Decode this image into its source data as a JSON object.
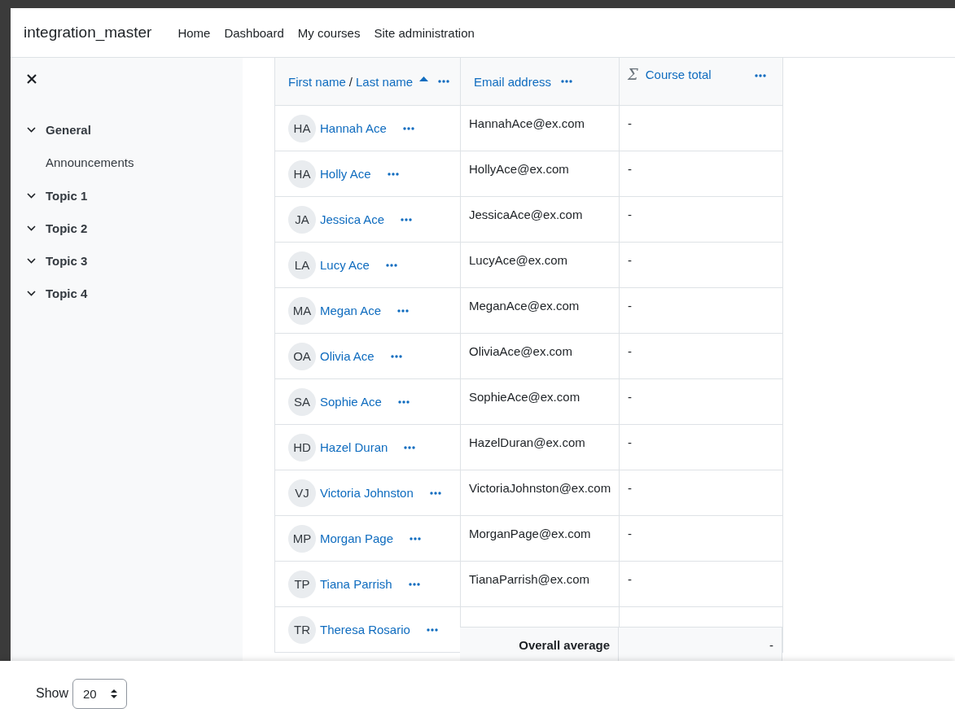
{
  "navbar": {
    "brand": "integration_master",
    "links": [
      "Home",
      "Dashboard",
      "My courses",
      "Site administration"
    ]
  },
  "sidebar": {
    "items": [
      {
        "label": "General",
        "expanded": true,
        "children": [
          {
            "label": "Announcements"
          }
        ]
      },
      {
        "label": "Topic 1",
        "expanded": true
      },
      {
        "label": "Topic 2",
        "expanded": true
      },
      {
        "label": "Topic 3",
        "expanded": true
      },
      {
        "label": "Topic 4",
        "expanded": true
      }
    ]
  },
  "table": {
    "columns": [
      {
        "kind": "name",
        "first_label": "First name",
        "separator": "/",
        "last_label": "Last name",
        "sorted_ascending": true
      },
      {
        "kind": "text",
        "label": "Email address"
      },
      {
        "kind": "total",
        "symbol": "Σ",
        "label": "Course total"
      }
    ],
    "rows": [
      {
        "initials": "HA",
        "name": "Hannah Ace",
        "email": "HannahAce@ex.com",
        "total": "-"
      },
      {
        "initials": "HA",
        "name": "Holly Ace",
        "email": "HollyAce@ex.com",
        "total": "-"
      },
      {
        "initials": "JA",
        "name": "Jessica Ace",
        "email": "JessicaAce@ex.com",
        "total": "-"
      },
      {
        "initials": "LA",
        "name": "Lucy Ace",
        "email": "LucyAce@ex.com",
        "total": "-"
      },
      {
        "initials": "MA",
        "name": "Megan Ace",
        "email": "MeganAce@ex.com",
        "total": "-"
      },
      {
        "initials": "OA",
        "name": "Olivia Ace",
        "email": "OliviaAce@ex.com",
        "total": "-"
      },
      {
        "initials": "SA",
        "name": "Sophie Ace",
        "email": "SophieAce@ex.com",
        "total": "-"
      },
      {
        "initials": "HD",
        "name": "Hazel Duran",
        "email": "HazelDuran@ex.com",
        "total": "-"
      },
      {
        "initials": "VJ",
        "name": "Victoria Johnston",
        "email": "VictoriaJohnston@ex.com",
        "total": "-"
      },
      {
        "initials": "MP",
        "name": "Morgan Page",
        "email": "MorganPage@ex.com",
        "total": "-"
      },
      {
        "initials": "TP",
        "name": "Tiana Parrish",
        "email": "TianaParrish@ex.com",
        "total": "-"
      },
      {
        "initials": "TR",
        "name": "Theresa Rosario"
      }
    ],
    "summary": {
      "label": "Overall average",
      "total": "-"
    }
  },
  "footer": {
    "label": "Show",
    "select_value": "20"
  }
}
